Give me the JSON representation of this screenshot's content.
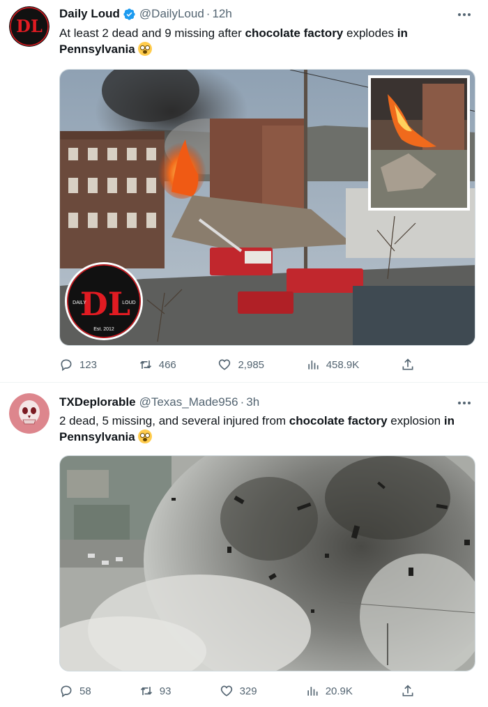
{
  "tweets": [
    {
      "name": "Daily Loud",
      "handle": "@DailyLoud",
      "separator": "·",
      "time": "12h",
      "text_parts": {
        "p1": "At least 2 dead and 9 missing after ",
        "b1": "chocolate factory",
        "p2": " explodes ",
        "b2": "in Pennsylvania"
      },
      "avatar_logo": "DL",
      "media_logo": {
        "left": "DAILY",
        "right": "LOUD",
        "est": "Est. 2012"
      },
      "actions": {
        "replies": "123",
        "retweets": "466",
        "likes": "2,985",
        "views": "458.9K"
      }
    },
    {
      "name": "TXDeplorable",
      "handle": "@Texas_Made956",
      "separator": "·",
      "time": "3h",
      "text_parts": {
        "p1": "2 dead, 5 missing, and several injured from ",
        "b1": "chocolate factory",
        "p2": " explosion ",
        "b2": "in Pennsylvania"
      },
      "actions": {
        "replies": "58",
        "retweets": "93",
        "likes": "329",
        "views": "20.9K"
      }
    }
  ],
  "icons": {
    "verified": "verified-badge-icon",
    "more": "more-icon",
    "reply": "reply-icon",
    "retweet": "retweet-icon",
    "like": "like-icon",
    "views": "views-icon",
    "share": "share-icon",
    "emoji": "flushed-face-emoji"
  },
  "colors": {
    "verified_blue": "#1d9bf0",
    "muted": "#536471",
    "text": "#0f1419",
    "logo_red": "#e11b22"
  }
}
